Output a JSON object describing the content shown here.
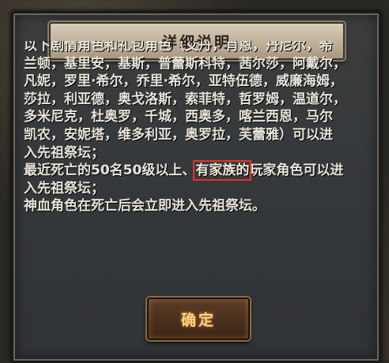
{
  "dialog": {
    "title": "详细说明",
    "lines": [
      "以下剧情角色和礼包角色（艾丹，肖恩，丹尼尔，希",
      "兰顿，基里安，基斯，普蕾斯科特，茜尔莎，阿戴尔，",
      "凡妮，罗里·希尔，乔里·希尔，亚特伍德，威廉海姆，",
      "莎拉，利亚德，奥戈洛斯，索菲特，哲罗姆，温道尔，",
      "多米尼克，杜奥罗，千城，西奥多，喀兰西恩，马尔",
      "凯农，安妮塔，维多利亚，奥罗拉，芙蕾雅）可以进",
      "入先祖祭坛；"
    ],
    "line_highlight": {
      "before": "最近死亡的50名50级以上、",
      "highlighted": "有家族的",
      "after": "玩家角色可以进"
    },
    "lines_after": [
      "入先祖祭坛；",
      "神血角色在死亡后会立即进入先祖祭坛。"
    ],
    "confirm_label": "确定"
  }
}
